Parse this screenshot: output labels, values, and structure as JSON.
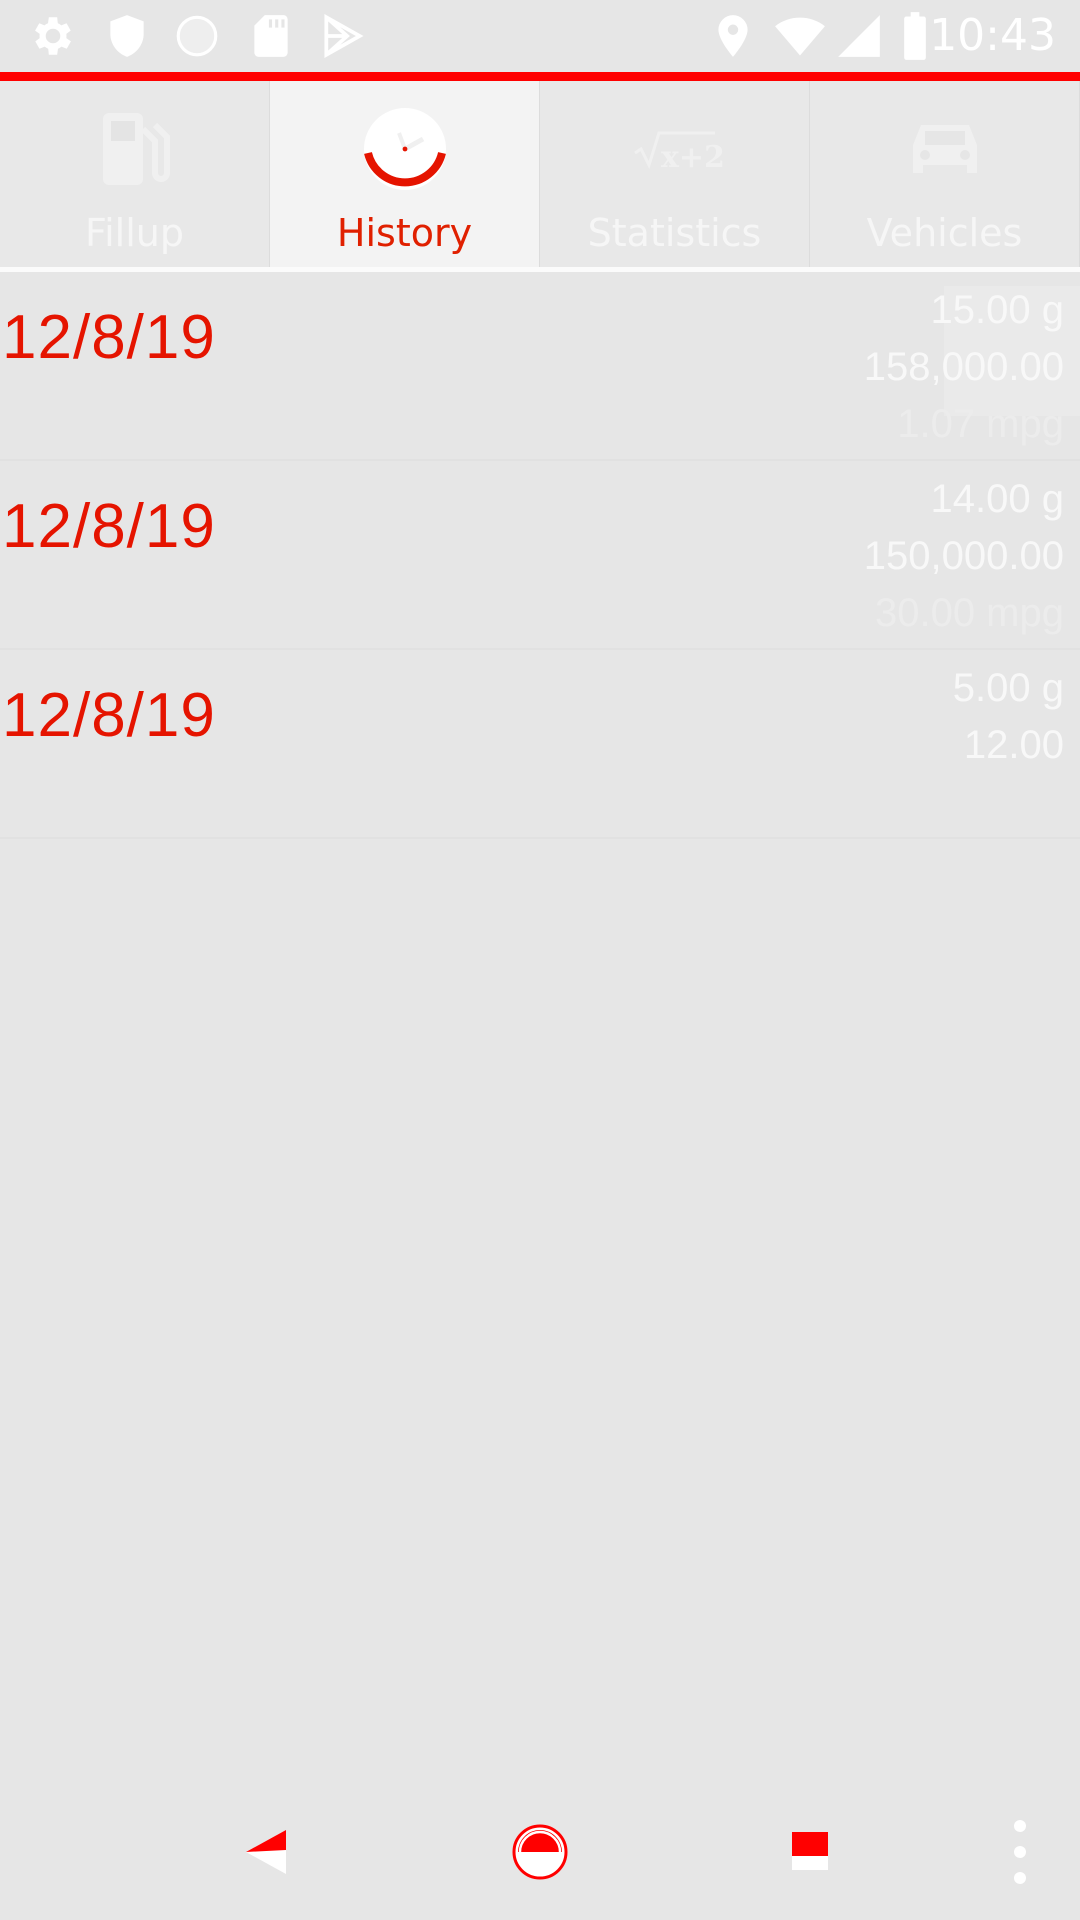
{
  "status_bar": {
    "time": "10:43",
    "left_icons": [
      "gear-icon",
      "shield-icon",
      "circle-icon",
      "sd-card-icon",
      "play-store-icon"
    ],
    "right_icons": [
      "location-icon",
      "wifi-icon",
      "signal-icon",
      "battery-icon"
    ]
  },
  "tabs": [
    {
      "label": "Fillup",
      "icon": "fuel-pump-icon",
      "active": false
    },
    {
      "label": "History",
      "icon": "clock-icon",
      "active": true
    },
    {
      "label": "Statistics",
      "icon": "formula-icon",
      "active": false
    },
    {
      "label": "Vehicles",
      "icon": "car-icon",
      "active": false
    }
  ],
  "history": [
    {
      "date": "12/8/19",
      "gallons": "15.00 g",
      "odometer": "158,000.00",
      "mpg": "1.07 mpg"
    },
    {
      "date": "12/8/19",
      "gallons": "14.00 g",
      "odometer": "150,000.00",
      "mpg": "30.00 mpg"
    },
    {
      "date": "12/8/19",
      "gallons": "5.00 g",
      "odometer": "12.00",
      "mpg": ""
    }
  ],
  "nav_bar": {
    "buttons": [
      "back-icon",
      "home-icon",
      "recents-icon",
      "more-icon"
    ]
  },
  "colors": {
    "accent": "#e51400",
    "background": "#e6e6e6",
    "highlight": "#ff0000"
  }
}
